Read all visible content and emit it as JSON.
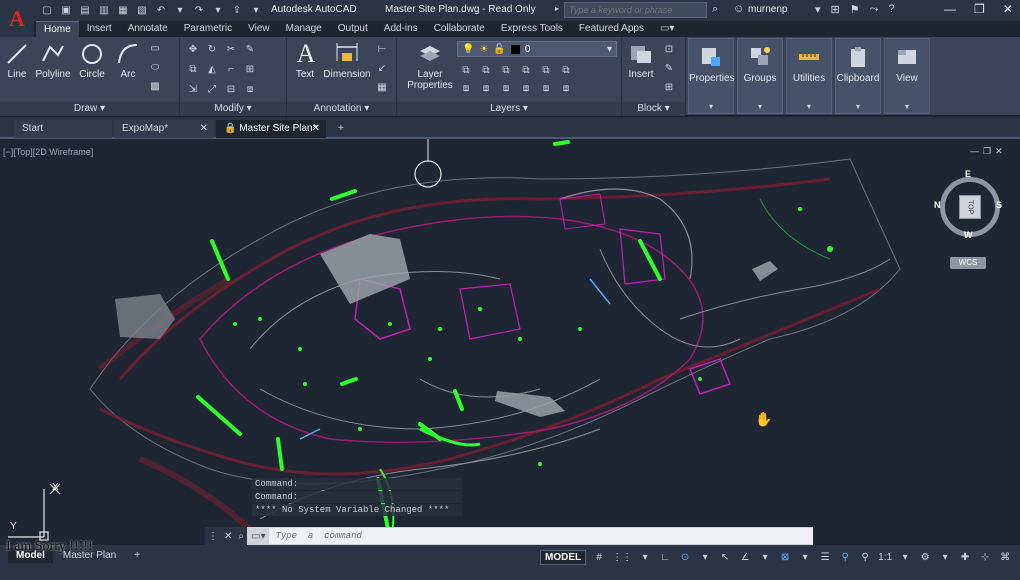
{
  "titlebar": {
    "app_name": "Autodesk AutoCAD",
    "file_title": "Master Site Plan.dwg - Read Only",
    "search_placeholder": "Type a keyword or phrase",
    "user": "murnenp",
    "logo": "A"
  },
  "ribbon_tabs": [
    "Home",
    "Insert",
    "Annotate",
    "Parametric",
    "View",
    "Manage",
    "Output",
    "Add-ins",
    "Collaborate",
    "Express Tools",
    "Featured Apps"
  ],
  "ribbon": {
    "draw": {
      "title": "Draw",
      "buttons": [
        "Line",
        "Polyline",
        "Circle",
        "Arc"
      ]
    },
    "modify": {
      "title": "Modify"
    },
    "annotation": {
      "title": "Annotation",
      "buttons": [
        "Text",
        "Dimension"
      ]
    },
    "layers": {
      "title": "Layers",
      "layer_properties": "Layer Properties",
      "current_layer": "0"
    },
    "block": {
      "title": "Block",
      "insert": "Insert"
    },
    "panels": [
      "Properties",
      "Groups",
      "Utilities",
      "Clipboard",
      "View"
    ]
  },
  "doc_tabs": [
    "Start",
    "ExpoMap*",
    "Master Site Plan*"
  ],
  "viewport": {
    "label": "[−][Top][2D Wireframe]",
    "viewcube": {
      "top": "TOP",
      "north": "N",
      "south": "S",
      "east": "E",
      "west": "W",
      "wcs": "WCS"
    }
  },
  "command": {
    "history": [
      "Command:",
      "Command:",
      "**** No System Variable Changed ****"
    ],
    "placeholder": "Type  a  command"
  },
  "layout_tabs": [
    "Model",
    "Master Plan"
  ],
  "status": {
    "model": "MODEL",
    "scale": "1:1"
  },
  "overlay_text": "I am Sorry !!!!!",
  "ucs": {
    "x": "X",
    "y": "Y"
  },
  "colors": {
    "accent": "#e0241b",
    "bg": "#1f2633",
    "green": "#2dff2d",
    "magenta": "#c21fb8",
    "red": "#9b1d2a"
  }
}
